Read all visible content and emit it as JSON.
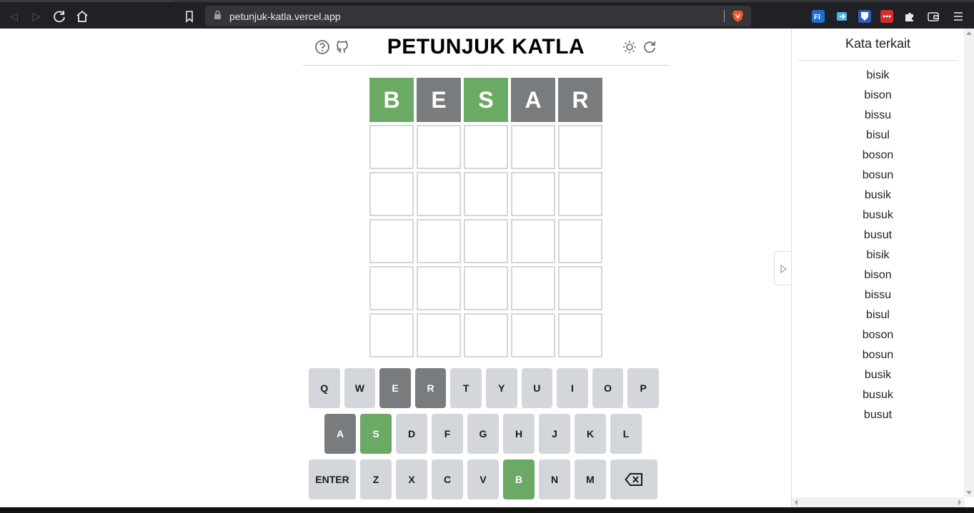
{
  "browser": {
    "url": "petunjuk-katla.vercel.app"
  },
  "header": {
    "title": "PETUNJUK KATLA"
  },
  "board": {
    "rows": [
      [
        {
          "letter": "B",
          "state": "correct"
        },
        {
          "letter": "E",
          "state": "absent"
        },
        {
          "letter": "S",
          "state": "correct"
        },
        {
          "letter": "A",
          "state": "absent"
        },
        {
          "letter": "R",
          "state": "absent"
        }
      ],
      [
        {
          "letter": "",
          "state": "empty"
        },
        {
          "letter": "",
          "state": "empty"
        },
        {
          "letter": "",
          "state": "empty"
        },
        {
          "letter": "",
          "state": "empty"
        },
        {
          "letter": "",
          "state": "empty"
        }
      ],
      [
        {
          "letter": "",
          "state": "empty"
        },
        {
          "letter": "",
          "state": "empty"
        },
        {
          "letter": "",
          "state": "empty"
        },
        {
          "letter": "",
          "state": "empty"
        },
        {
          "letter": "",
          "state": "empty"
        }
      ],
      [
        {
          "letter": "",
          "state": "empty"
        },
        {
          "letter": "",
          "state": "empty"
        },
        {
          "letter": "",
          "state": "empty"
        },
        {
          "letter": "",
          "state": "empty"
        },
        {
          "letter": "",
          "state": "empty"
        }
      ],
      [
        {
          "letter": "",
          "state": "empty"
        },
        {
          "letter": "",
          "state": "empty"
        },
        {
          "letter": "",
          "state": "empty"
        },
        {
          "letter": "",
          "state": "empty"
        },
        {
          "letter": "",
          "state": "empty"
        }
      ],
      [
        {
          "letter": "",
          "state": "empty"
        },
        {
          "letter": "",
          "state": "empty"
        },
        {
          "letter": "",
          "state": "empty"
        },
        {
          "letter": "",
          "state": "empty"
        },
        {
          "letter": "",
          "state": "empty"
        }
      ]
    ]
  },
  "keyboard": {
    "rows": [
      [
        {
          "label": "Q",
          "state": "unused"
        },
        {
          "label": "W",
          "state": "unused"
        },
        {
          "label": "E",
          "state": "absent"
        },
        {
          "label": "R",
          "state": "absent"
        },
        {
          "label": "T",
          "state": "unused"
        },
        {
          "label": "Y",
          "state": "unused"
        },
        {
          "label": "U",
          "state": "unused"
        },
        {
          "label": "I",
          "state": "unused"
        },
        {
          "label": "O",
          "state": "unused"
        },
        {
          "label": "P",
          "state": "unused"
        }
      ],
      [
        {
          "label": "A",
          "state": "absent"
        },
        {
          "label": "S",
          "state": "correct"
        },
        {
          "label": "D",
          "state": "unused"
        },
        {
          "label": "F",
          "state": "unused"
        },
        {
          "label": "G",
          "state": "unused"
        },
        {
          "label": "H",
          "state": "unused"
        },
        {
          "label": "J",
          "state": "unused"
        },
        {
          "label": "K",
          "state": "unused"
        },
        {
          "label": "L",
          "state": "unused"
        }
      ],
      [
        {
          "label": "ENTER",
          "state": "unused",
          "wide": true
        },
        {
          "label": "Z",
          "state": "unused"
        },
        {
          "label": "X",
          "state": "unused"
        },
        {
          "label": "C",
          "state": "unused"
        },
        {
          "label": "V",
          "state": "unused"
        },
        {
          "label": "B",
          "state": "correct"
        },
        {
          "label": "N",
          "state": "unused"
        },
        {
          "label": "M",
          "state": "unused"
        },
        {
          "label": "",
          "state": "unused",
          "wide": true,
          "icon": "backspace-icon"
        }
      ]
    ]
  },
  "sidebar": {
    "title": "Kata terkait",
    "words": [
      "bisik",
      "bison",
      "bissu",
      "bisul",
      "boson",
      "bosun",
      "busik",
      "busuk",
      "busut",
      "bisik",
      "bison",
      "bissu",
      "bisul",
      "boson",
      "bosun",
      "busik",
      "busuk",
      "busut"
    ]
  },
  "colors": {
    "correct": "#6aaa64",
    "absent": "#787c7e",
    "key_default": "#d3d6da"
  }
}
